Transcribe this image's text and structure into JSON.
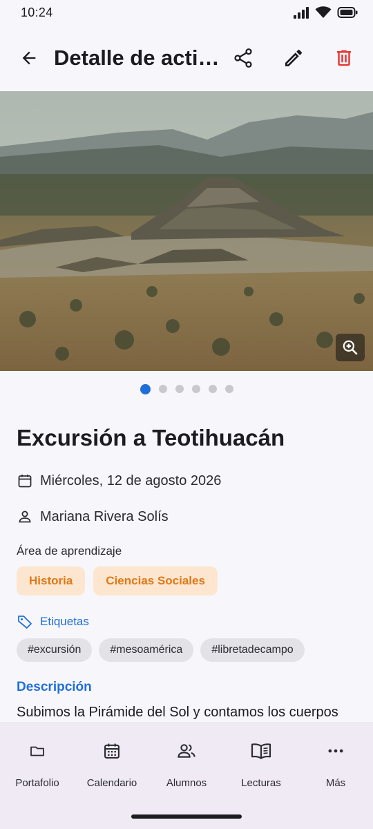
{
  "status_bar": {
    "time": "10:24"
  },
  "app_bar": {
    "title": "Detalle de actividad"
  },
  "gallery": {
    "total": 6,
    "current": 1
  },
  "activity": {
    "title": "Excursión a Teotihuacán",
    "date": "Miércoles, 12 de agosto 2026",
    "student": "Mariana Rivera Solís",
    "area_label": "Área de aprendizaje",
    "areas": [
      "Historia",
      "Ciencias Sociales"
    ],
    "tags_label": "Etiquetas",
    "tags": [
      "#excursión",
      "#mesoamérica",
      "#libretadecampo"
    ],
    "description_label": "Descripción",
    "description": "Subimos la Pirámide del Sol y contamos los cuerpos"
  },
  "bottom_nav": {
    "items": [
      {
        "label": "Portafolio",
        "icon": "folder-icon"
      },
      {
        "label": "Calendario",
        "icon": "calendar-icon"
      },
      {
        "label": "Alumnos",
        "icon": "people-icon"
      },
      {
        "label": "Lecturas",
        "icon": "book-icon"
      },
      {
        "label": "Más",
        "icon": "more-icon"
      }
    ]
  },
  "colors": {
    "accent": "#1f6fd9",
    "delete": "#e53935",
    "area_chip_bg": "#fde6cf",
    "area_chip_text": "#e07818"
  }
}
